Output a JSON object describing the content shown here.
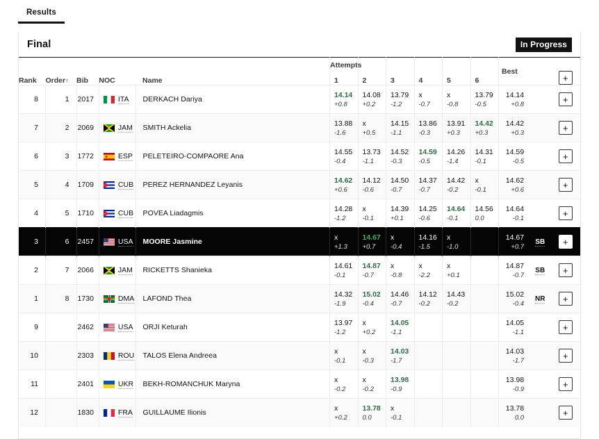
{
  "tabs": [
    {
      "label": "Results",
      "active": true
    }
  ],
  "card": {
    "title": "Final",
    "status": "In Progress"
  },
  "columns": {
    "rank": "Rank",
    "order": "Order",
    "order_sort": "↑",
    "bib": "Bib",
    "noc": "NOC",
    "name": "Name",
    "attempts_group": "Attempts",
    "attempt_numbers": [
      "1",
      "2",
      "3",
      "4",
      "5",
      "6"
    ],
    "best": "Best",
    "add": "+"
  },
  "colors": {
    "best_mark": "#2f6b46",
    "best_mark_selected": "#4caf6d",
    "selected_row_bg": "#050505",
    "status_badge_bg": "#111111",
    "accent_underline": "#111111"
  },
  "rows": [
    {
      "rank": "8",
      "order": "1",
      "bib": "2017",
      "noc": "ITA",
      "name": "DERKACH Dariya",
      "flag": "flag-italy",
      "record": "",
      "selected": false,
      "attempts": [
        {
          "mark": "14.14",
          "wind": "+0.8",
          "best": true
        },
        {
          "mark": "14.08",
          "wind": "+0.2",
          "best": false
        },
        {
          "mark": "13.79",
          "wind": "-1.2",
          "best": false
        },
        {
          "mark": "x",
          "wind": "-0.7",
          "best": false
        },
        {
          "mark": "x",
          "wind": "-0.8",
          "best": false
        },
        {
          "mark": "13.79",
          "wind": "-0.5",
          "best": false
        }
      ],
      "best_mark": "14.14",
      "best_wind": "+0.8"
    },
    {
      "rank": "7",
      "order": "2",
      "bib": "2069",
      "noc": "JAM",
      "name": "SMITH Ackelia",
      "flag": "flag-jamaica",
      "record": "",
      "selected": false,
      "attempts": [
        {
          "mark": "13.88",
          "wind": "-1.6",
          "best": false
        },
        {
          "mark": "x",
          "wind": "+0.5",
          "best": false
        },
        {
          "mark": "14.15",
          "wind": "-1.1",
          "best": false
        },
        {
          "mark": "13.86",
          "wind": "-0.3",
          "best": false
        },
        {
          "mark": "13.91",
          "wind": "+0.3",
          "best": false
        },
        {
          "mark": "14.42",
          "wind": "+0.3",
          "best": true
        }
      ],
      "best_mark": "14.42",
      "best_wind": "+0.3"
    },
    {
      "rank": "6",
      "order": "3",
      "bib": "1772",
      "noc": "ESP",
      "name": "PELETEIRO-COMPAORE Ana",
      "flag": "flag-spain",
      "record": "",
      "selected": false,
      "attempts": [
        {
          "mark": "14.55",
          "wind": "-0.4",
          "best": false
        },
        {
          "mark": "13.73",
          "wind": "-1.1",
          "best": false
        },
        {
          "mark": "14.52",
          "wind": "-0.3",
          "best": false
        },
        {
          "mark": "14.59",
          "wind": "-0.5",
          "best": true
        },
        {
          "mark": "14.26",
          "wind": "-1.4",
          "best": false
        },
        {
          "mark": "14.31",
          "wind": "-0.1",
          "best": false
        }
      ],
      "best_mark": "14.59",
      "best_wind": "-0.5"
    },
    {
      "rank": "5",
      "order": "4",
      "bib": "1709",
      "noc": "CUB",
      "name": "PEREZ HERNANDEZ Leyanis",
      "flag": "flag-cuba",
      "record": "",
      "selected": false,
      "attempts": [
        {
          "mark": "14.62",
          "wind": "+0.6",
          "best": true
        },
        {
          "mark": "14.12",
          "wind": "-0.6",
          "best": false
        },
        {
          "mark": "14.50",
          "wind": "-0.7",
          "best": false
        },
        {
          "mark": "14.37",
          "wind": "-0.7",
          "best": false
        },
        {
          "mark": "14.42",
          "wind": "-0.2",
          "best": false
        },
        {
          "mark": "x",
          "wind": "-0.1",
          "best": false
        }
      ],
      "best_mark": "14.62",
      "best_wind": "+0.6"
    },
    {
      "rank": "4",
      "order": "5",
      "bib": "1710",
      "noc": "CUB",
      "name": "POVEA Liadagmis",
      "flag": "flag-cuba",
      "record": "",
      "selected": false,
      "attempts": [
        {
          "mark": "14.28",
          "wind": "-1.2",
          "best": false
        },
        {
          "mark": "x",
          "wind": "-0.1",
          "best": false
        },
        {
          "mark": "14.39",
          "wind": "+0.1",
          "best": false
        },
        {
          "mark": "14.25",
          "wind": "-0.6",
          "best": false
        },
        {
          "mark": "14.64",
          "wind": "-0.1",
          "best": true
        },
        {
          "mark": "14.56",
          "wind": "0.0",
          "best": false
        }
      ],
      "best_mark": "14.64",
      "best_wind": "-0.1"
    },
    {
      "rank": "3",
      "order": "6",
      "bib": "2457",
      "noc": "USA",
      "name": "MOORE Jasmine",
      "flag": "flag-usa",
      "record": "SB",
      "selected": true,
      "attempts": [
        {
          "mark": "x",
          "wind": "+1.3",
          "best": false
        },
        {
          "mark": "14.67",
          "wind": "+0.7",
          "best": true
        },
        {
          "mark": "x",
          "wind": "-0.4",
          "best": false
        },
        {
          "mark": "14.16",
          "wind": "-1.5",
          "best": false
        },
        {
          "mark": "x",
          "wind": "-1.0",
          "best": false
        },
        {
          "mark": "",
          "wind": "",
          "best": false
        }
      ],
      "best_mark": "14.67",
      "best_wind": "+0.7"
    },
    {
      "rank": "2",
      "order": "7",
      "bib": "2066",
      "noc": "JAM",
      "name": "RICKETTS Shanieka",
      "flag": "flag-jamaica",
      "record": "SB",
      "selected": false,
      "attempts": [
        {
          "mark": "14.61",
          "wind": "-0.1",
          "best": false
        },
        {
          "mark": "14.87",
          "wind": "-0.7",
          "best": true
        },
        {
          "mark": "x",
          "wind": "-0.8",
          "best": false
        },
        {
          "mark": "x",
          "wind": "-2.2",
          "best": false
        },
        {
          "mark": "x",
          "wind": "+0.1",
          "best": false
        },
        {
          "mark": "",
          "wind": "",
          "best": false
        }
      ],
      "best_mark": "14.87",
      "best_wind": "-0.7"
    },
    {
      "rank": "1",
      "order": "8",
      "bib": "1730",
      "noc": "DMA",
      "name": "LAFOND Thea",
      "flag": "flag-dominica",
      "record": "NR",
      "selected": false,
      "attempts": [
        {
          "mark": "14.32",
          "wind": "-1.9",
          "best": false
        },
        {
          "mark": "15.02",
          "wind": "-0.4",
          "best": true
        },
        {
          "mark": "14.46",
          "wind": "-0.7",
          "best": false
        },
        {
          "mark": "14.12",
          "wind": "-0.2",
          "best": false
        },
        {
          "mark": "14.43",
          "wind": "-0.2",
          "best": false
        },
        {
          "mark": "",
          "wind": "",
          "best": false
        }
      ],
      "best_mark": "15.02",
      "best_wind": "-0.4"
    },
    {
      "rank": "9",
      "order": "",
      "bib": "2462",
      "noc": "USA",
      "name": "ORJI Keturah",
      "flag": "flag-usa",
      "record": "",
      "selected": false,
      "attempts": [
        {
          "mark": "13.97",
          "wind": "-1.2",
          "best": false
        },
        {
          "mark": "x",
          "wind": "+0.2",
          "best": false
        },
        {
          "mark": "14.05",
          "wind": "-1.1",
          "best": true
        },
        {
          "mark": "",
          "wind": "",
          "best": false
        },
        {
          "mark": "",
          "wind": "",
          "best": false
        },
        {
          "mark": "",
          "wind": "",
          "best": false
        }
      ],
      "best_mark": "14.05",
      "best_wind": "-1.1"
    },
    {
      "rank": "10",
      "order": "",
      "bib": "2303",
      "noc": "ROU",
      "name": "TALOS Elena Andreea",
      "flag": "flag-romania",
      "record": "",
      "selected": false,
      "attempts": [
        {
          "mark": "x",
          "wind": "-0.1",
          "best": false
        },
        {
          "mark": "x",
          "wind": "-0.3",
          "best": false
        },
        {
          "mark": "14.03",
          "wind": "-1.7",
          "best": true
        },
        {
          "mark": "",
          "wind": "",
          "best": false
        },
        {
          "mark": "",
          "wind": "",
          "best": false
        },
        {
          "mark": "",
          "wind": "",
          "best": false
        }
      ],
      "best_mark": "14.03",
      "best_wind": "-1.7"
    },
    {
      "rank": "11",
      "order": "",
      "bib": "2401",
      "noc": "UKR",
      "name": "BEKH-ROMANCHUK Maryna",
      "flag": "flag-ukraine",
      "record": "",
      "selected": false,
      "attempts": [
        {
          "mark": "x",
          "wind": "-0.2",
          "best": false
        },
        {
          "mark": "x",
          "wind": "-0.2",
          "best": false
        },
        {
          "mark": "13.98",
          "wind": "-0.9",
          "best": true
        },
        {
          "mark": "",
          "wind": "",
          "best": false
        },
        {
          "mark": "",
          "wind": "",
          "best": false
        },
        {
          "mark": "",
          "wind": "",
          "best": false
        }
      ],
      "best_mark": "13.98",
      "best_wind": "-0.9"
    },
    {
      "rank": "12",
      "order": "",
      "bib": "1830",
      "noc": "FRA",
      "name": "GUILLAUME Ilionis",
      "flag": "flag-france",
      "record": "",
      "selected": false,
      "attempts": [
        {
          "mark": "x",
          "wind": "+0.2",
          "best": false
        },
        {
          "mark": "13.78",
          "wind": "0.0",
          "best": true
        },
        {
          "mark": "x",
          "wind": "-0.1",
          "best": false
        },
        {
          "mark": "",
          "wind": "",
          "best": false
        },
        {
          "mark": "",
          "wind": "",
          "best": false
        },
        {
          "mark": "",
          "wind": "",
          "best": false
        }
      ],
      "best_mark": "13.78",
      "best_wind": "0.0"
    }
  ]
}
